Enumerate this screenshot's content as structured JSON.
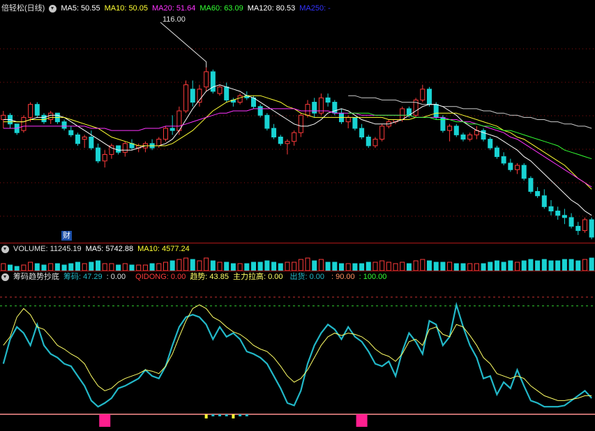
{
  "colors": {
    "up": "#ff3b3b",
    "down": "#19d3d3",
    "ma5": "#ffffff",
    "ma10": "#ffff33",
    "ma20": "#ff33ff",
    "ma60": "#33ff33",
    "ma120": "#ffffff",
    "ma250": "#3333ff",
    "grid": "#8a1010",
    "dotted": "#c83232",
    "indicator_main": "#22b8c8",
    "indicator_signal": "#ffff66",
    "pink_bar": "#ff1f8f",
    "base_line": "#ff9090"
  },
  "main_legend": {
    "stock_name": "倍轻松(日线)",
    "ma5": "MA5: 50.55",
    "ma10": "MA10: 50.05",
    "ma20": "MA20: 51.64",
    "ma60": "MA60: 63.09",
    "ma120": "MA120: 80.53",
    "ma250": "MA250: -"
  },
  "price_marker": "116.00",
  "finance_badge": "财",
  "volume_legend": {
    "volume": "VOLUME: 11245.19",
    "ma5": "MA5: 5742.88",
    "ma10": "MA10: 4577.24"
  },
  "indicator_legend": {
    "name": "筹码趋势抄底",
    "chip": "筹码: 47.29",
    "chip2": ": 0.00",
    "qidong": "QIDONG: 0.00",
    "trend": "趋势: 43.85",
    "main_raise": "主力拉高: 0.00",
    "ship": "出货: 0.00",
    "lvl90": ": 90.00",
    "lvl100": ": 100.00"
  },
  "chart_data": [
    {
      "type": "candlestick",
      "name": "price",
      "ylim": [
        0,
        100
      ],
      "candles": [
        [
          54,
          58,
          50,
          56
        ],
        [
          56,
          57,
          50,
          52
        ],
        [
          52,
          52,
          47,
          48
        ],
        [
          49,
          56,
          48,
          55
        ],
        [
          55,
          62,
          53,
          61
        ],
        [
          61,
          62,
          55,
          56
        ],
        [
          56,
          57,
          52,
          53
        ],
        [
          54,
          58,
          52,
          57
        ],
        [
          57,
          57,
          52,
          53
        ],
        [
          53,
          54,
          49,
          50
        ],
        [
          49,
          51,
          46,
          47
        ],
        [
          47,
          48,
          42,
          43
        ],
        [
          45,
          47,
          41,
          46
        ],
        [
          46,
          49,
          40,
          41
        ],
        [
          41,
          43,
          34,
          35
        ],
        [
          35,
          40,
          32,
          38
        ],
        [
          38,
          43,
          36,
          42
        ],
        [
          42,
          42,
          38,
          39
        ],
        [
          39,
          44,
          37,
          43
        ],
        [
          43,
          45,
          40,
          41
        ],
        [
          41,
          43,
          39,
          42
        ],
        [
          41,
          44,
          39,
          43
        ],
        [
          43,
          45,
          40,
          41
        ],
        [
          42,
          46,
          41,
          45
        ],
        [
          45,
          51,
          44,
          50
        ],
        [
          50,
          56,
          47,
          49
        ],
        [
          49,
          60,
          47,
          58
        ],
        [
          58,
          72,
          57,
          70
        ],
        [
          68,
          72,
          60,
          62
        ],
        [
          62,
          70,
          60,
          68
        ],
        [
          69,
          78,
          67,
          76
        ],
        [
          76,
          77,
          66,
          67
        ],
        [
          66,
          70,
          65,
          69
        ],
        [
          69,
          71,
          62,
          63
        ],
        [
          63,
          64,
          60,
          62
        ],
        [
          62,
          66,
          61,
          65
        ],
        [
          65,
          67,
          63,
          64
        ],
        [
          64,
          65,
          59,
          60
        ],
        [
          60,
          61,
          55,
          56
        ],
        [
          56,
          57,
          49,
          50
        ],
        [
          50,
          52,
          45,
          46
        ],
        [
          46,
          47,
          42,
          43
        ],
        [
          43,
          45,
          38,
          44
        ],
        [
          44,
          49,
          42,
          48
        ],
        [
          48,
          57,
          46,
          56
        ],
        [
          56,
          63,
          55,
          61
        ],
        [
          62,
          64,
          55,
          57
        ],
        [
          57,
          66,
          56,
          64
        ],
        [
          64,
          66,
          60,
          62
        ],
        [
          62,
          63,
          56,
          57
        ],
        [
          57,
          59,
          52,
          53
        ],
        [
          53,
          56,
          50,
          55
        ],
        [
          55,
          55,
          49,
          50
        ],
        [
          50,
          52,
          45,
          46
        ],
        [
          46,
          47,
          41,
          42
        ],
        [
          42,
          46,
          41,
          45
        ],
        [
          45,
          52,
          44,
          51
        ],
        [
          51,
          54,
          50,
          53
        ],
        [
          53,
          54,
          52,
          54
        ],
        [
          54,
          60,
          53,
          59
        ],
        [
          59,
          60,
          55,
          56
        ],
        [
          56,
          64,
          55,
          63
        ],
        [
          63,
          70,
          62,
          68
        ],
        [
          68,
          69,
          60,
          61
        ],
        [
          61,
          62,
          54,
          55
        ],
        [
          55,
          56,
          48,
          49
        ],
        [
          49,
          52,
          44,
          51
        ],
        [
          51,
          52,
          46,
          47
        ],
        [
          47,
          48,
          44,
          45
        ],
        [
          45,
          48,
          44,
          47
        ],
        [
          47,
          51,
          45,
          49
        ],
        [
          49,
          50,
          44,
          45
        ],
        [
          45,
          46,
          40,
          41
        ],
        [
          41,
          42,
          36,
          37
        ],
        [
          37,
          39,
          33,
          34
        ],
        [
          34,
          36,
          30,
          31
        ],
        [
          31,
          34,
          29,
          33
        ],
        [
          33,
          34,
          26,
          27
        ],
        [
          27,
          28,
          20,
          21
        ],
        [
          21,
          23,
          18,
          19
        ],
        [
          19,
          22,
          13,
          14
        ],
        [
          14,
          17,
          10,
          12
        ],
        [
          12,
          14,
          8,
          10
        ],
        [
          10,
          13,
          6,
          9
        ],
        [
          9,
          11,
          4,
          5
        ],
        [
          5,
          7,
          1,
          3
        ],
        [
          3,
          9,
          2,
          8
        ],
        [
          8,
          9,
          -1,
          0
        ]
      ]
    },
    {
      "type": "line",
      "name": "moving_averages",
      "series": [
        {
          "name": "MA5",
          "values": [
            54,
            54,
            53,
            53,
            54,
            55,
            55,
            56,
            56,
            55,
            53,
            51,
            49,
            47,
            45,
            43,
            41,
            40,
            40,
            40,
            41,
            42,
            42,
            42,
            43,
            45,
            49,
            54,
            59,
            63,
            67,
            69,
            70,
            69,
            68,
            67,
            65,
            64,
            62,
            60,
            58,
            56,
            54,
            52,
            51,
            51,
            52,
            54,
            57,
            58,
            59,
            58,
            56,
            54,
            53,
            52,
            52,
            52,
            53,
            54,
            56,
            58,
            60,
            61,
            61,
            60,
            58,
            56,
            53,
            51,
            49,
            48,
            47,
            46,
            44,
            42,
            40,
            37,
            35,
            32,
            29,
            26,
            23,
            20,
            17,
            15,
            12,
            10
          ]
        },
        {
          "name": "MA10",
          "values": [
            53,
            53,
            53,
            53,
            54,
            54,
            54,
            55,
            55,
            55,
            54,
            53,
            52,
            51,
            50,
            48,
            46,
            45,
            44,
            43,
            42,
            42,
            42,
            42,
            42,
            43,
            45,
            47,
            49,
            52,
            55,
            58,
            60,
            62,
            63,
            64,
            65,
            65,
            65,
            64,
            63,
            62,
            60,
            59,
            57,
            56,
            55,
            55,
            55,
            55,
            55,
            55,
            55,
            55,
            55,
            55,
            55,
            54,
            54,
            54,
            54,
            55,
            55,
            56,
            57,
            57,
            57,
            57,
            56,
            55,
            54,
            53,
            52,
            51,
            49,
            48,
            46,
            45,
            43,
            41,
            39,
            37,
            35,
            33,
            30,
            27,
            25,
            22
          ]
        },
        {
          "name": "MA20",
          "values": [
            50,
            50,
            50,
            51,
            51,
            51,
            51,
            51,
            51,
            51,
            51,
            51,
            51,
            50,
            50,
            50,
            49,
            49,
            49,
            49,
            49,
            50,
            50,
            50,
            51,
            51,
            51,
            52,
            53,
            54,
            55,
            56,
            57,
            57,
            58,
            58,
            58,
            59,
            59,
            59,
            59,
            59,
            59,
            59,
            58,
            58,
            58,
            58,
            58,
            57,
            57,
            57,
            57,
            56,
            56,
            56,
            56,
            56,
            56,
            56,
            56,
            55,
            55,
            55,
            55,
            55,
            54,
            54,
            53,
            53,
            52,
            51,
            50,
            49,
            48,
            46,
            45,
            43,
            41,
            39,
            37,
            35,
            33,
            31,
            29,
            27,
            25,
            23
          ]
        },
        {
          "name": "MA60",
          "values": [
            null,
            null,
            null,
            null,
            null,
            null,
            null,
            null,
            null,
            null,
            null,
            null,
            null,
            null,
            null,
            null,
            null,
            null,
            null,
            null,
            null,
            null,
            null,
            null,
            null,
            null,
            null,
            null,
            null,
            null,
            null,
            null,
            null,
            null,
            null,
            null,
            null,
            null,
            null,
            null,
            null,
            null,
            null,
            null,
            null,
            null,
            null,
            null,
            null,
            null,
            null,
            57,
            57,
            57,
            57,
            56,
            56,
            56,
            56,
            56,
            56,
            55,
            55,
            55,
            54,
            54,
            54,
            53,
            53,
            52,
            52,
            51,
            51,
            50,
            49,
            49,
            48,
            47,
            46,
            45,
            44,
            43,
            42,
            40,
            39,
            38,
            37,
            36
          ]
        },
        {
          "name": "MA120",
          "values": [
            null,
            null,
            null,
            null,
            null,
            null,
            null,
            null,
            null,
            null,
            null,
            null,
            null,
            null,
            null,
            null,
            null,
            null,
            null,
            null,
            null,
            null,
            null,
            null,
            null,
            null,
            null,
            null,
            null,
            null,
            null,
            null,
            null,
            null,
            null,
            null,
            null,
            null,
            null,
            null,
            null,
            null,
            null,
            null,
            null,
            null,
            null,
            null,
            null,
            null,
            null,
            65,
            65,
            64,
            64,
            64,
            63,
            63,
            63,
            62,
            62,
            62,
            61,
            61,
            61,
            60,
            60,
            60,
            59,
            59,
            59,
            58,
            58,
            57,
            57,
            56,
            56,
            55,
            55,
            54,
            54,
            53,
            53,
            52,
            52,
            51,
            51,
            50
          ]
        }
      ]
    },
    {
      "type": "bar",
      "name": "volume",
      "values": [
        5,
        4,
        3,
        4,
        6,
        5,
        4,
        5,
        5,
        4,
        5,
        6,
        5,
        6,
        7,
        5,
        5,
        4,
        5,
        4,
        4,
        4,
        5,
        5,
        6,
        7,
        8,
        9,
        8,
        7,
        9,
        7,
        6,
        6,
        5,
        5,
        5,
        6,
        6,
        7,
        6,
        5,
        6,
        6,
        8,
        9,
        7,
        8,
        6,
        6,
        5,
        5,
        5,
        5,
        6,
        6,
        7,
        6,
        5,
        6,
        5,
        7,
        8,
        7,
        6,
        6,
        6,
        5,
        5,
        5,
        5,
        5,
        6,
        7,
        6,
        7,
        6,
        7,
        8,
        7,
        8,
        7,
        7,
        8,
        8,
        7,
        8,
        9
      ]
    },
    {
      "type": "line",
      "name": "indicator",
      "ylim": [
        0,
        100
      ],
      "series": [
        {
          "name": "筹码",
          "values": [
            40,
            60,
            70,
            65,
            55,
            72,
            55,
            48,
            45,
            40,
            38,
            30,
            22,
            10,
            5,
            8,
            12,
            20,
            22,
            25,
            28,
            35,
            30,
            28,
            38,
            55,
            70,
            78,
            80,
            78,
            72,
            60,
            70,
            62,
            65,
            60,
            50,
            48,
            45,
            40,
            30,
            20,
            8,
            6,
            18,
            40,
            55,
            65,
            72,
            68,
            60,
            70,
            62,
            58,
            50,
            40,
            38,
            42,
            30,
            50,
            65,
            58,
            48,
            75,
            72,
            55,
            62,
            88,
            70,
            55,
            45,
            28,
            30,
            15,
            25,
            20,
            35,
            22,
            10,
            8,
            5,
            5,
            5,
            6,
            10,
            14,
            18,
            12
          ]
        },
        {
          "name": "趋势",
          "values": [
            55,
            62,
            78,
            85,
            80,
            70,
            68,
            62,
            55,
            52,
            48,
            45,
            40,
            30,
            22,
            18,
            20,
            25,
            28,
            30,
            32,
            35,
            34,
            32,
            38,
            48,
            62,
            75,
            85,
            88,
            85,
            78,
            75,
            70,
            66,
            64,
            60,
            55,
            52,
            50,
            45,
            38,
            30,
            25,
            28,
            35,
            45,
            55,
            62,
            65,
            63,
            65,
            64,
            62,
            58,
            52,
            48,
            46,
            42,
            48,
            58,
            60,
            55,
            68,
            70,
            64,
            62,
            72,
            70,
            63,
            55,
            45,
            40,
            32,
            30,
            28,
            30,
            28,
            22,
            18,
            14,
            12,
            10,
            10,
            11,
            12,
            14,
            14
          ]
        }
      ],
      "pink_bars_at": [
        15,
        53
      ]
    }
  ]
}
